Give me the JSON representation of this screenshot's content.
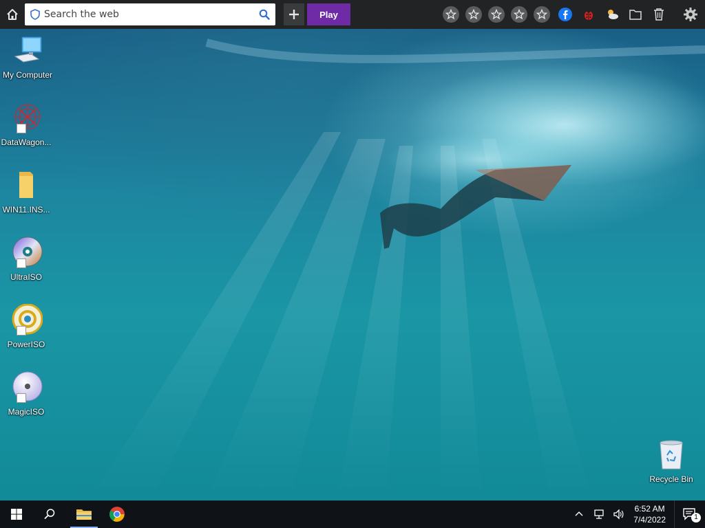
{
  "toolbar": {
    "search_placeholder": "Search the web",
    "play_label": "Play",
    "icons": [
      "home-icon",
      "shield-icon",
      "search-icon",
      "plus-icon",
      "star-icon",
      "star-icon",
      "star-icon",
      "star-icon",
      "star-icon",
      "facebook-icon",
      "ladybug-icon",
      "weather-icon",
      "folder-icon",
      "trash-icon",
      "gear-icon"
    ]
  },
  "desktop": {
    "icons": [
      {
        "label": "My Computer"
      },
      {
        "label": "DataWagon..."
      },
      {
        "label": "WIN11.INS..."
      },
      {
        "label": "UltraISO"
      },
      {
        "label": "PowerISO"
      },
      {
        "label": "MagicISO"
      },
      {
        "label": "Recycle Bin"
      }
    ]
  },
  "taskbar": {
    "time": "6:52 AM",
    "date": "7/4/2022",
    "notification_count": "1"
  },
  "colors": {
    "toolbar_bg": "#222325",
    "play_button": "#6f2aa6",
    "taskbar_bg": "#0f1317"
  }
}
